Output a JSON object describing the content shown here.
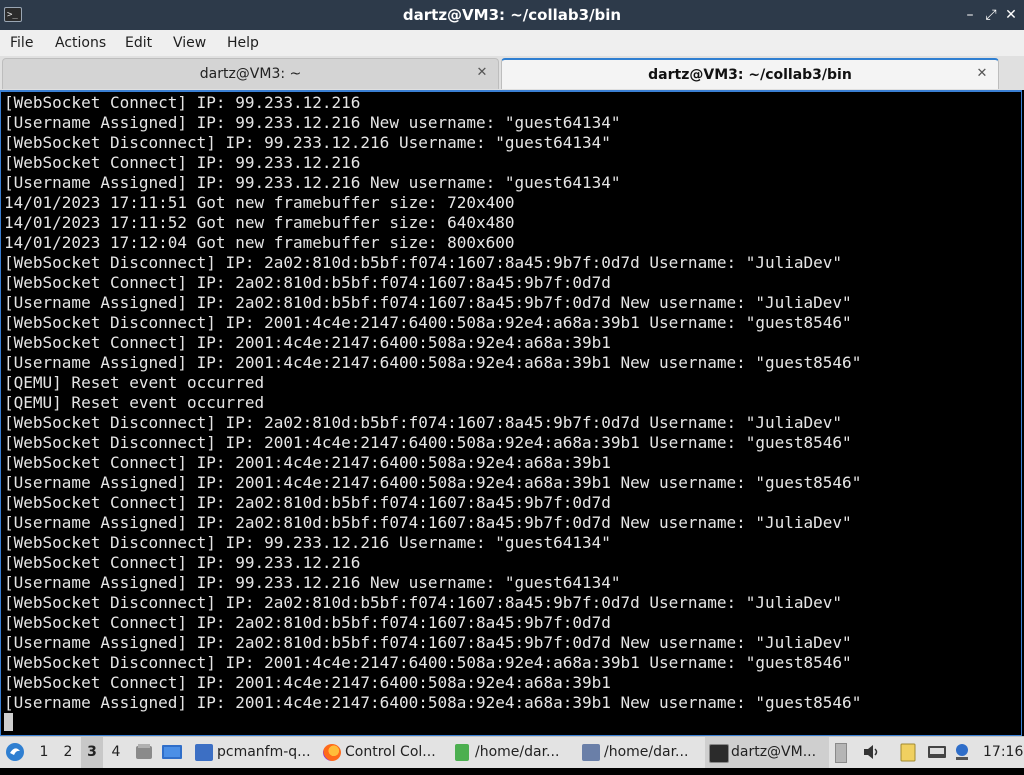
{
  "window": {
    "title": "dartz@VM3: ~/collab3/bin",
    "app_icon": "terminal-icon",
    "controls": {
      "minimize": "–",
      "restore": "⤢",
      "close": "✕"
    }
  },
  "menu": {
    "file": "File",
    "actions": "Actions",
    "edit": "Edit",
    "view": "View",
    "help": "Help"
  },
  "tabs": [
    {
      "label": "dartz@VM3: ~",
      "close": "✕",
      "active": false
    },
    {
      "label": "dartz@VM3: ~/collab3/bin",
      "close": "✕",
      "active": true
    }
  ],
  "terminal": {
    "lines": [
      "[WebSocket Connect] IP: 99.233.12.216",
      "[Username Assigned] IP: 99.233.12.216 New username: \"guest64134\"",
      "[WebSocket Disconnect] IP: 99.233.12.216 Username: \"guest64134\"",
      "[WebSocket Connect] IP: 99.233.12.216",
      "[Username Assigned] IP: 99.233.12.216 New username: \"guest64134\"",
      "14/01/2023 17:11:51 Got new framebuffer size: 720x400",
      "14/01/2023 17:11:52 Got new framebuffer size: 640x480",
      "14/01/2023 17:12:04 Got new framebuffer size: 800x600",
      "[WebSocket Disconnect] IP: 2a02:810d:b5bf:f074:1607:8a45:9b7f:0d7d Username: \"JuliaDev\"",
      "[WebSocket Connect] IP: 2a02:810d:b5bf:f074:1607:8a45:9b7f:0d7d",
      "[Username Assigned] IP: 2a02:810d:b5bf:f074:1607:8a45:9b7f:0d7d New username: \"JuliaDev\"",
      "[WebSocket Disconnect] IP: 2001:4c4e:2147:6400:508a:92e4:a68a:39b1 Username: \"guest8546\"",
      "[WebSocket Connect] IP: 2001:4c4e:2147:6400:508a:92e4:a68a:39b1",
      "[Username Assigned] IP: 2001:4c4e:2147:6400:508a:92e4:a68a:39b1 New username: \"guest8546\"",
      "[QEMU] Reset event occurred",
      "[QEMU] Reset event occurred",
      "[WebSocket Disconnect] IP: 2a02:810d:b5bf:f074:1607:8a45:9b7f:0d7d Username: \"JuliaDev\"",
      "[WebSocket Disconnect] IP: 2001:4c4e:2147:6400:508a:92e4:a68a:39b1 Username: \"guest8546\"",
      "[WebSocket Connect] IP: 2001:4c4e:2147:6400:508a:92e4:a68a:39b1",
      "[Username Assigned] IP: 2001:4c4e:2147:6400:508a:92e4:a68a:39b1 New username: \"guest8546\"",
      "[WebSocket Connect] IP: 2a02:810d:b5bf:f074:1607:8a45:9b7f:0d7d",
      "[Username Assigned] IP: 2a02:810d:b5bf:f074:1607:8a45:9b7f:0d7d New username: \"JuliaDev\"",
      "[WebSocket Disconnect] IP: 99.233.12.216 Username: \"guest64134\"",
      "[WebSocket Connect] IP: 99.233.12.216",
      "[Username Assigned] IP: 99.233.12.216 New username: \"guest64134\"",
      "[WebSocket Disconnect] IP: 2a02:810d:b5bf:f074:1607:8a45:9b7f:0d7d Username: \"JuliaDev\"",
      "[WebSocket Connect] IP: 2a02:810d:b5bf:f074:1607:8a45:9b7f:0d7d",
      "[Username Assigned] IP: 2a02:810d:b5bf:f074:1607:8a45:9b7f:0d7d New username: \"JuliaDev\"",
      "[WebSocket Disconnect] IP: 2001:4c4e:2147:6400:508a:92e4:a68a:39b1 Username: \"guest8546\"",
      "[WebSocket Connect] IP: 2001:4c4e:2147:6400:508a:92e4:a68a:39b1",
      "[Username Assigned] IP: 2001:4c4e:2147:6400:508a:92e4:a68a:39b1 New username: \"guest8546\""
    ]
  },
  "taskbar": {
    "start_icon": "lxqt-menu-icon",
    "workspaces": [
      "1",
      "2",
      "3",
      "4"
    ],
    "active_workspace": "3",
    "quicklaunch": [
      "file-manager-icon",
      "show-desktop-icon"
    ],
    "tasks": [
      {
        "label": "pcmanfm-q...",
        "icon": "folder-icon"
      },
      {
        "label": "Control Col...",
        "icon": "firefox-icon"
      },
      {
        "label": "/home/dar...",
        "icon": "text-file-icon"
      },
      {
        "label": "/home/dar...",
        "icon": "editor-icon"
      },
      {
        "label": "dartz@VM...",
        "icon": "terminal-icon"
      }
    ],
    "tray": [
      "notes-icon",
      "volume-icon",
      "clipboard-icon",
      "keyboard-icon",
      "network-icon"
    ],
    "clock": "17:16"
  }
}
